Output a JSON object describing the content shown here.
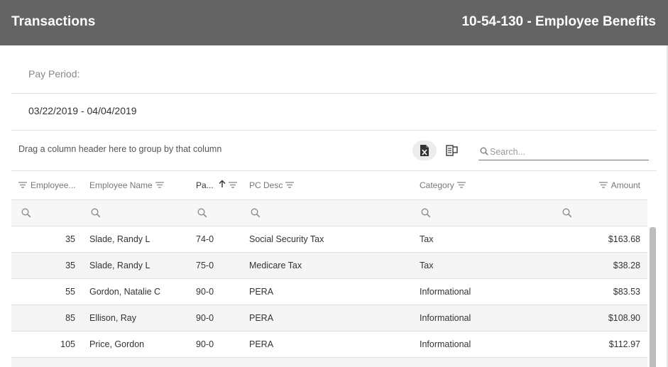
{
  "header": {
    "title": "Transactions",
    "subtitle": "10-54-130 - Employee Benefits"
  },
  "pay_period": {
    "label": "Pay Period:",
    "value": "03/22/2019 - 04/04/2019"
  },
  "toolbar": {
    "group_hint": "Drag a column header here to group by that column",
    "export_icon": "excel-export-icon",
    "column_chooser_icon": "column-chooser-icon",
    "search_placeholder": "Search..."
  },
  "columns": [
    {
      "label": "Employee..."
    },
    {
      "label": "Employee Name"
    },
    {
      "label": "Pa...",
      "sort": "ascending"
    },
    {
      "label": "PC Desc"
    },
    {
      "label": "Category"
    },
    {
      "label": "Amount"
    }
  ],
  "rows": [
    [
      "35",
      "Slade, Randy L",
      "74-0",
      "Social Security Tax",
      "Tax",
      "$163.68"
    ],
    [
      "35",
      "Slade, Randy L",
      "75-0",
      "Medicare Tax",
      "Tax",
      "$38.28"
    ],
    [
      "55",
      "Gordon, Natalie C",
      "90-0",
      "PERA",
      "Informational",
      "$83.53"
    ],
    [
      "85",
      "Ellison, Ray",
      "90-0",
      "PERA",
      "Informational",
      "$108.90"
    ],
    [
      "105",
      "Price, Gordon",
      "90-0",
      "PERA",
      "Informational",
      "$112.97"
    ]
  ],
  "colors": {
    "header_bg": "#646464",
    "alt_row_bg": "#f5f5f5",
    "filter_row_bg": "#f7f7f7"
  }
}
